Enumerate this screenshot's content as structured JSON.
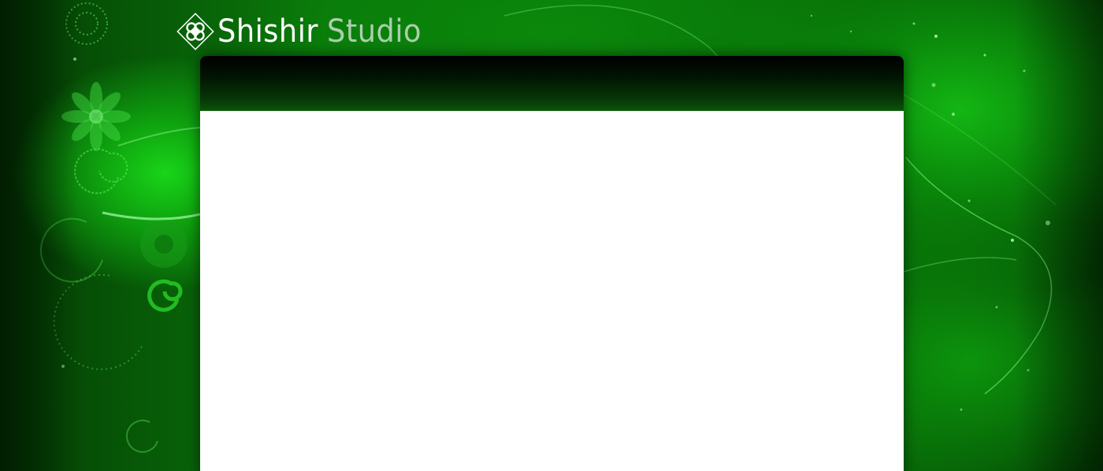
{
  "brand": {
    "name_part1": "Shishir",
    "name_part2": "Studio",
    "logo_icon": "clover-diamond-icon"
  },
  "colors": {
    "background_green": "#0a7a0a",
    "bright_green": "#19d419",
    "dark_green": "#022a02",
    "panel_body": "#ffffff",
    "panel_header_top": "#000000",
    "panel_header_bottom": "#0a520a"
  }
}
